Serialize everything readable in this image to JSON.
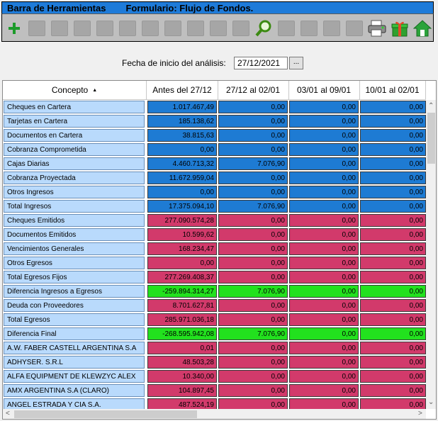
{
  "header": {
    "toolbar_label": "Barra de Herramientas",
    "form_title": "Formulario: Flujo de Fondos."
  },
  "toolbar": {
    "buttons": [
      {
        "icon": "add-icon",
        "enabled": true
      },
      {
        "icon": "save-icon",
        "enabled": false
      },
      {
        "icon": "save-as-icon",
        "enabled": false
      },
      {
        "icon": "edit-icon",
        "enabled": false
      },
      {
        "icon": "print-disabled-icon",
        "enabled": false
      },
      {
        "icon": "undo-icon",
        "enabled": false
      },
      {
        "icon": "help-icon",
        "enabled": false
      },
      {
        "icon": "film-icon",
        "enabled": false
      },
      {
        "icon": "tool-a-icon",
        "enabled": false
      },
      {
        "icon": "tool-b-icon",
        "enabled": false
      },
      {
        "icon": "tool-c-icon",
        "enabled": false
      },
      {
        "icon": "search-icon",
        "enabled": true
      },
      {
        "icon": "first-record-icon",
        "enabled": false
      },
      {
        "icon": "prev-record-icon",
        "enabled": false
      },
      {
        "icon": "next-record-icon",
        "enabled": false
      },
      {
        "icon": "last-record-icon",
        "enabled": false
      },
      {
        "icon": "printer-icon",
        "enabled": true
      },
      {
        "icon": "gift-icon",
        "enabled": true
      },
      {
        "icon": "home-icon",
        "enabled": true
      }
    ]
  },
  "filter": {
    "label": "Fecha de inicio del análisis:",
    "date_value": "27/12/2021",
    "button_label": "..."
  },
  "table": {
    "columns": [
      "Concepto",
      "Antes del 27/12",
      "27/12 al 02/01",
      "03/01 al 09/01",
      "10/01 al 02/01"
    ],
    "sort_indicator": "▲",
    "rows": [
      {
        "label": "Cheques en Cartera",
        "color": "blue",
        "values": [
          "1.017.467,49",
          "0,00",
          "0,00",
          "0,00"
        ]
      },
      {
        "label": "Tarjetas en Cartera",
        "color": "blue",
        "values": [
          "185.138,62",
          "0,00",
          "0,00",
          "0,00"
        ]
      },
      {
        "label": "Documentos en Cartera",
        "color": "blue",
        "values": [
          "38.815,63",
          "0,00",
          "0,00",
          "0,00"
        ]
      },
      {
        "label": "Cobranza Comprometida",
        "color": "blue",
        "values": [
          "0,00",
          "0,00",
          "0,00",
          "0,00"
        ]
      },
      {
        "label": "Cajas Diarias",
        "color": "blue",
        "values": [
          "4.460.713,32",
          "7.076,90",
          "0,00",
          "0,00"
        ]
      },
      {
        "label": "Cobranza Proyectada",
        "color": "blue",
        "values": [
          "11.672.959,04",
          "0,00",
          "0,00",
          "0,00"
        ]
      },
      {
        "label": "Otros Ingresos",
        "color": "blue",
        "values": [
          "0,00",
          "0,00",
          "0,00",
          "0,00"
        ]
      },
      {
        "label": "Total Ingresos",
        "color": "blue",
        "values": [
          "17.375.094,10",
          "7.076,90",
          "0,00",
          "0,00"
        ]
      },
      {
        "label": "Cheques Emitidos",
        "color": "pink",
        "values": [
          "277.090.574,28",
          "0,00",
          "0,00",
          "0,00"
        ]
      },
      {
        "label": "Documentos Emitidos",
        "color": "pink",
        "values": [
          "10.599,62",
          "0,00",
          "0,00",
          "0,00"
        ]
      },
      {
        "label": "Vencimientos Generales",
        "color": "pink",
        "values": [
          "168.234,47",
          "0,00",
          "0,00",
          "0,00"
        ]
      },
      {
        "label": "Otros Egresos",
        "color": "pink",
        "values": [
          "0,00",
          "0,00",
          "0,00",
          "0,00"
        ]
      },
      {
        "label": "Total Egresos Fijos",
        "color": "pink",
        "values": [
          "277.269.408,37",
          "0,00",
          "0,00",
          "0,00"
        ]
      },
      {
        "label": "Diferencia Ingresos a Egresos",
        "color": "green",
        "values": [
          "-259.894.314,27",
          "7.076,90",
          "0,00",
          "0,00"
        ]
      },
      {
        "label": "Deuda con Proveedores",
        "color": "pink",
        "values": [
          "8.701.627,81",
          "0,00",
          "0,00",
          "0,00"
        ]
      },
      {
        "label": "Total Egresos",
        "color": "pink",
        "values": [
          "285.971.036,18",
          "0,00",
          "0,00",
          "0,00"
        ]
      },
      {
        "label": "Diferencia Final",
        "color": "green",
        "values": [
          "-268.595.942,08",
          "7.076,90",
          "0,00",
          "0,00"
        ]
      },
      {
        "label": "A.W. FABER CASTELL ARGENTINA S.A",
        "color": "pink",
        "values": [
          "0,01",
          "0,00",
          "0,00",
          "0,00"
        ]
      },
      {
        "label": "ADHYSER. S.R.L",
        "color": "pink",
        "values": [
          "48.503,28",
          "0,00",
          "0,00",
          "0,00"
        ]
      },
      {
        "label": "ALFA EQUIPMENT DE KLEWZYC ALEX",
        "color": "pink",
        "values": [
          "10.340,00",
          "0,00",
          "0,00",
          "0,00"
        ]
      },
      {
        "label": "AMX ARGENTINA S.A (CLARO)",
        "color": "pink",
        "values": [
          "104.897,45",
          "0,00",
          "0,00",
          "0,00"
        ]
      },
      {
        "label": "ANGEL ESTRADA Y CIA S.A.",
        "color": "pink",
        "values": [
          "487.524,19",
          "0,00",
          "0,00",
          "0,00"
        ]
      }
    ]
  },
  "colors": {
    "title_bar": "#1e7bd9",
    "income": "#1e7bd3",
    "expense": "#d23a6b",
    "difference": "#22e11e",
    "concept": "#b9dafc"
  }
}
